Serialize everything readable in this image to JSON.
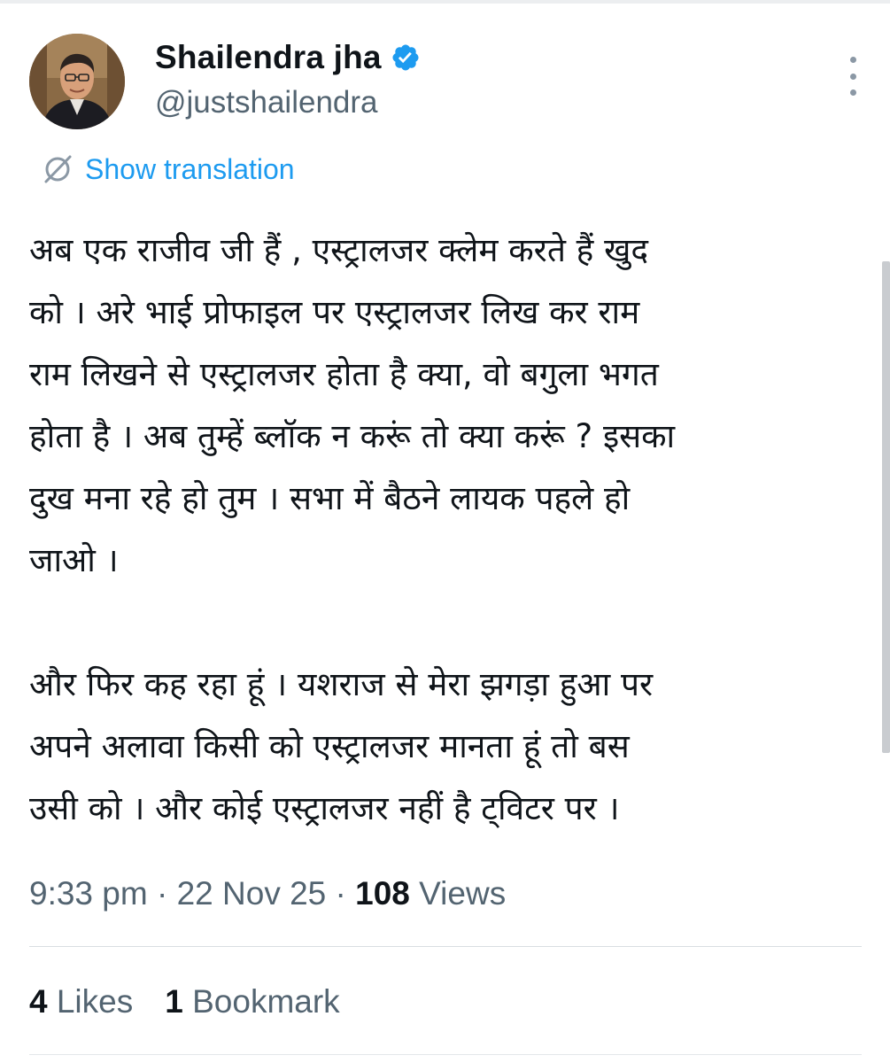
{
  "user": {
    "display_name": "Shailendra jha",
    "handle": "@justshailendra",
    "verified": true
  },
  "translation_link": "Show translation",
  "tweet": {
    "lines": [
      "अब एक राजीव जी हैं , एस्ट्रालजर क्लेम करते हैं खुद",
      "को । अरे भाई प्रोफाइल पर एस्ट्रालजर लिख कर राम",
      "राम लिखने से एस्ट्रालजर होता है क्या, वो बगुला भगत",
      "होता है । अब तुम्हें ब्लॉक न करूं तो क्या करूं ? इसका",
      "दुख मना रहे हो तुम । सभा में बैठने लायक पहले हो",
      "जाओ ।",
      "",
      "और फिर कह रहा हूं । यशराज से मेरा झगड़ा हुआ पर",
      "अपने अलावा किसी को एस्ट्रालजर मानता हूं तो बस",
      "उसी को । और कोई एस्ट्रालजर नहीं है ट्विटर पर ।"
    ]
  },
  "meta": {
    "time": "9:33 pm",
    "date": "22 Nov 25",
    "separator": "·",
    "views_count": "108",
    "views_label": "Views"
  },
  "stats": {
    "likes_count": "4",
    "likes_label": "Likes",
    "bookmarks_count": "1",
    "bookmarks_label": "Bookmark"
  },
  "colors": {
    "accent": "#1d9bf0",
    "secondary_text": "#536471",
    "primary_text": "#0f1419"
  },
  "icons": {
    "verified": "verified-badge-icon",
    "translate": "globe-slash-icon",
    "more": "vertical-ellipsis-icon"
  }
}
